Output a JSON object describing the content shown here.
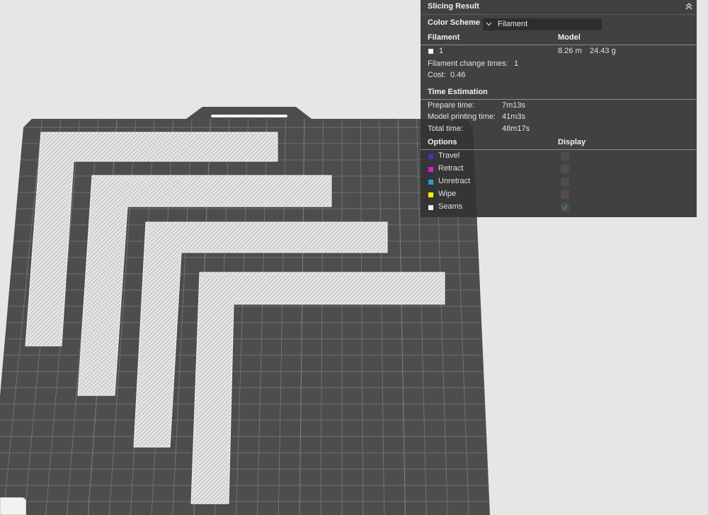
{
  "panel": {
    "title": "Slicing Result",
    "color_scheme_label": "Color Scheme",
    "color_scheme_value": "Filament",
    "filament_header": "Filament",
    "model_header": "Model",
    "filament_index": "1",
    "filament_color": "#ffffff",
    "filament_length": "8.26 m",
    "filament_weight": "24.43 g",
    "change_times_label": "Filament change times:",
    "change_times_value": "1",
    "cost_label": "Cost:",
    "cost_value": "0.46",
    "time_header": "Time Estimation",
    "prepare_label": "Prepare time:",
    "prepare_value": "7m13s",
    "model_print_label": "Model printing time:",
    "model_print_value": "41m3s",
    "total_label": "Total time:",
    "total_value": "48m17s",
    "options_header": "Options",
    "display_header": "Display",
    "options": [
      {
        "label": "Travel",
        "color": "#3a3ab4",
        "checked": false
      },
      {
        "label": "Retract",
        "color": "#d21ed2",
        "checked": false
      },
      {
        "label": "Unretract",
        "color": "#28a0d2",
        "checked": false
      },
      {
        "label": "Wipe",
        "color": "#f0f000",
        "checked": false
      },
      {
        "label": "Seams",
        "color": "#f2f2f2",
        "checked": true
      }
    ]
  },
  "theme": {
    "bed_color": "#4d4d4d",
    "grid_color": "#7a7a7a",
    "part_color": "#d8d8d8",
    "check_color": "#1f9e4f"
  }
}
